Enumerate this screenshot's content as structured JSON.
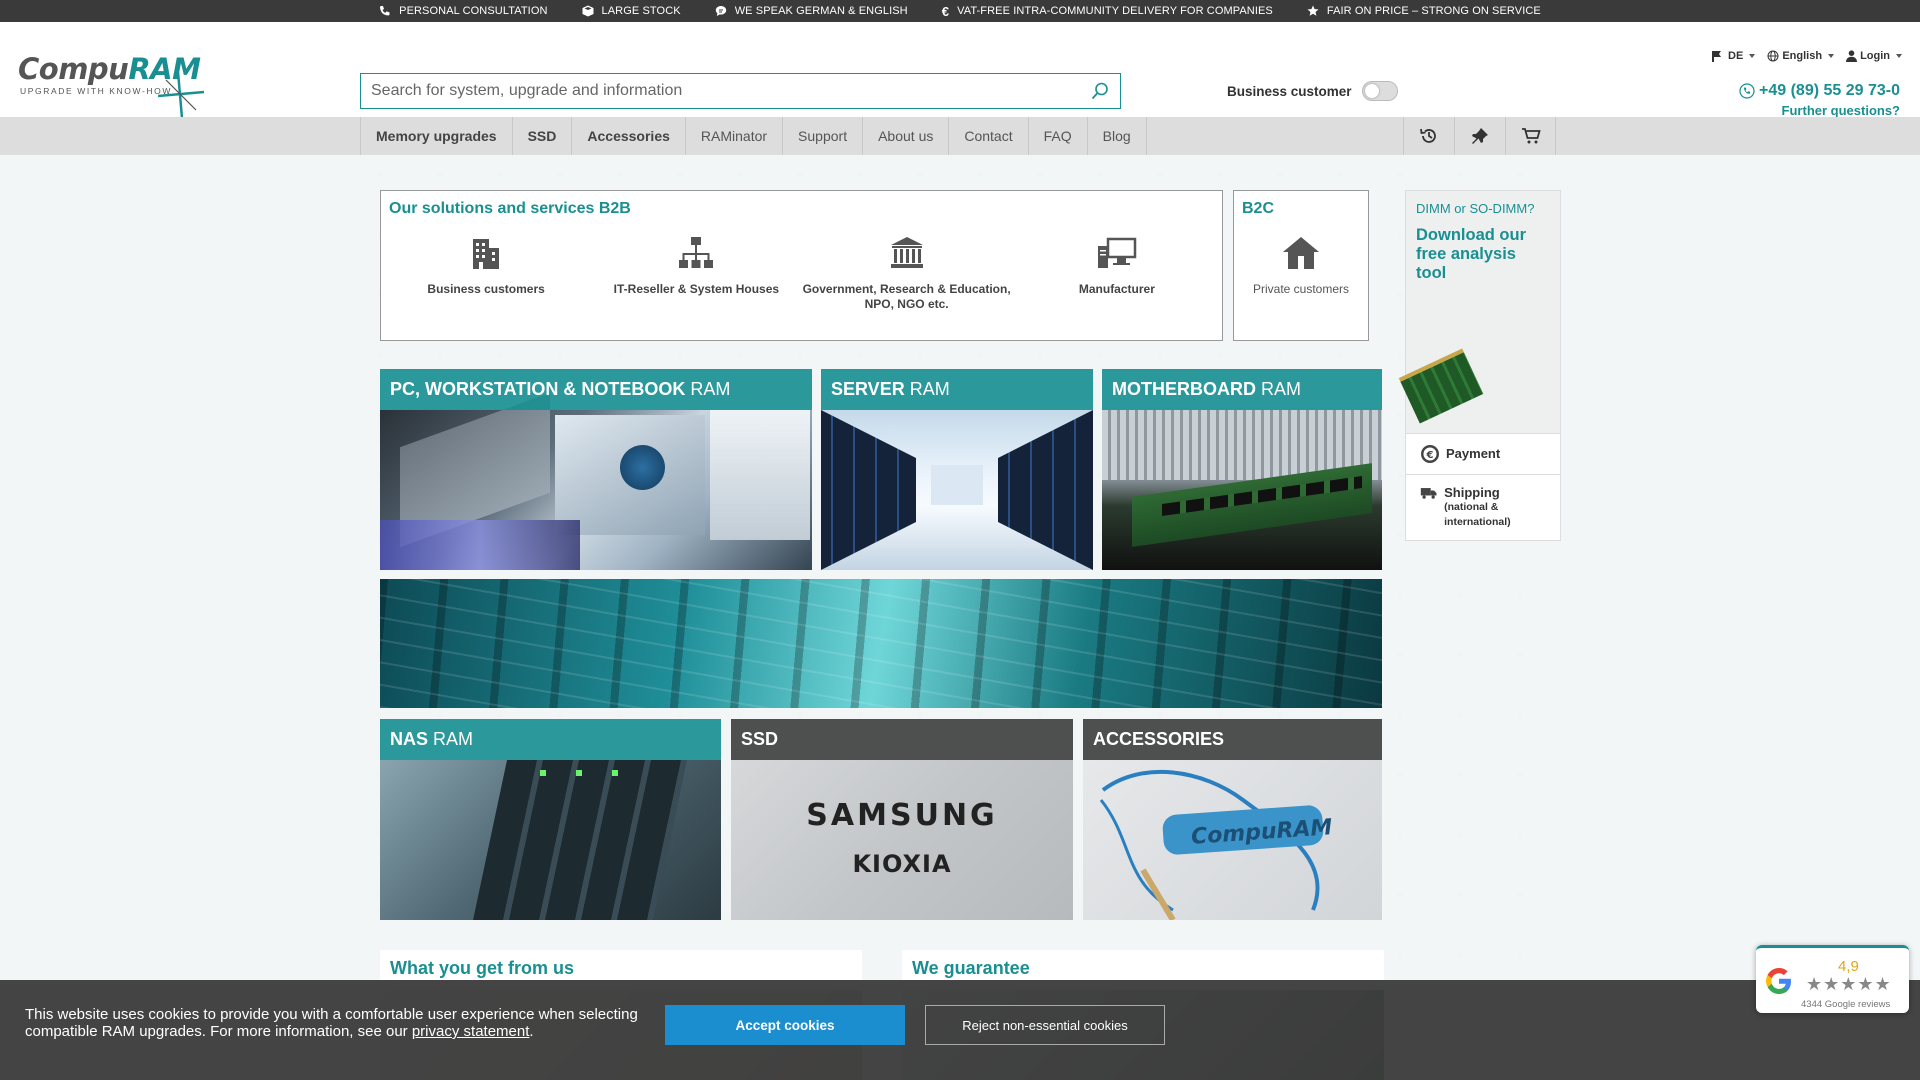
{
  "topbar": {
    "usps": [
      {
        "icon": "phone-icon",
        "text": "PERSONAL CONSULTATION"
      },
      {
        "icon": "box-icon",
        "text": "LARGE STOCK"
      },
      {
        "icon": "speech-icon",
        "text": "WE SPEAK GERMAN & ENGLISH"
      },
      {
        "icon": "euro-icon",
        "text": "VAT-FREE INTRA-COMMUNITY DELIVERY FOR COMPANIES"
      },
      {
        "icon": "star-icon",
        "text": "FAIR ON PRICE – STRONG ON SERVICE"
      }
    ]
  },
  "header": {
    "logo_main": "Compu",
    "logo_accent": "RAM",
    "logo_tagline": "UPGRADE WITH KNOW-HOW",
    "search_placeholder": "Search for system, upgrade and information",
    "business_customer_label": "Business customer",
    "country": "DE",
    "language": "English",
    "login": "Login",
    "phone": "+49 (89) 55 29 73-0",
    "further_questions": "Further questions?"
  },
  "nav": {
    "items": [
      "Memory upgrades",
      "SSD",
      "Accessories",
      "RAMinator",
      "Support",
      "About us",
      "Contact",
      "FAQ",
      "Blog"
    ]
  },
  "solutions": {
    "title": "Our solutions and services B2B",
    "items": [
      {
        "icon": "building-icon",
        "label": "Business customers"
      },
      {
        "icon": "network-hierarchy-icon",
        "label": "IT-Reseller & System Houses"
      },
      {
        "icon": "government-building-icon",
        "label": "Government, Research & Education,\nNPO, NGO etc."
      },
      {
        "icon": "workstation-icon",
        "label": "Manufacturer"
      }
    ],
    "b2c_title": "B2C",
    "b2c_label": "Private customers"
  },
  "tiles": {
    "pc": {
      "bold": "PC, WORKSTATION & NOTEBOOK",
      "rest": "RAM"
    },
    "server": {
      "bold": "SERVER",
      "rest": "RAM"
    },
    "motherboard": {
      "bold": "MOTHERBOARD",
      "rest": "RAM"
    },
    "nas": {
      "bold": "NAS",
      "rest": "RAM"
    },
    "ssd": {
      "bold": "SSD",
      "rest": ""
    },
    "accessories": {
      "bold": "ACCESSORIES",
      "rest": ""
    },
    "arrow": "",
    "ssd_brand1": "SAMSUNG",
    "ssd_brand2": "KIOXIA",
    "strap_brand": "CompuRAM"
  },
  "sidebar": {
    "question": "DIMM or SO-DIMM?",
    "download": "Download our free analysis tool",
    "arrow": "",
    "payment": "Payment",
    "shipping": "Shipping",
    "shipping_sub": "(national & international)"
  },
  "promos": {
    "left_title": "What you get from us",
    "right_title": "We guarantee"
  },
  "cookie": {
    "text": "This website uses cookies to provide you with a comfortable user experience when selecting compatible RAM upgrades. For more information, see our",
    "link": "privacy statement",
    "period": ".",
    "accept": "Accept cookies",
    "reject": "Reject non-essential cookies"
  },
  "google": {
    "score": "4,9",
    "stars": "★★★★★",
    "reviews": "4344 Google reviews"
  },
  "colors": {
    "accent": "#1a8f92",
    "dark": "#3a3a3a",
    "button_blue": "#1a8ecf"
  }
}
